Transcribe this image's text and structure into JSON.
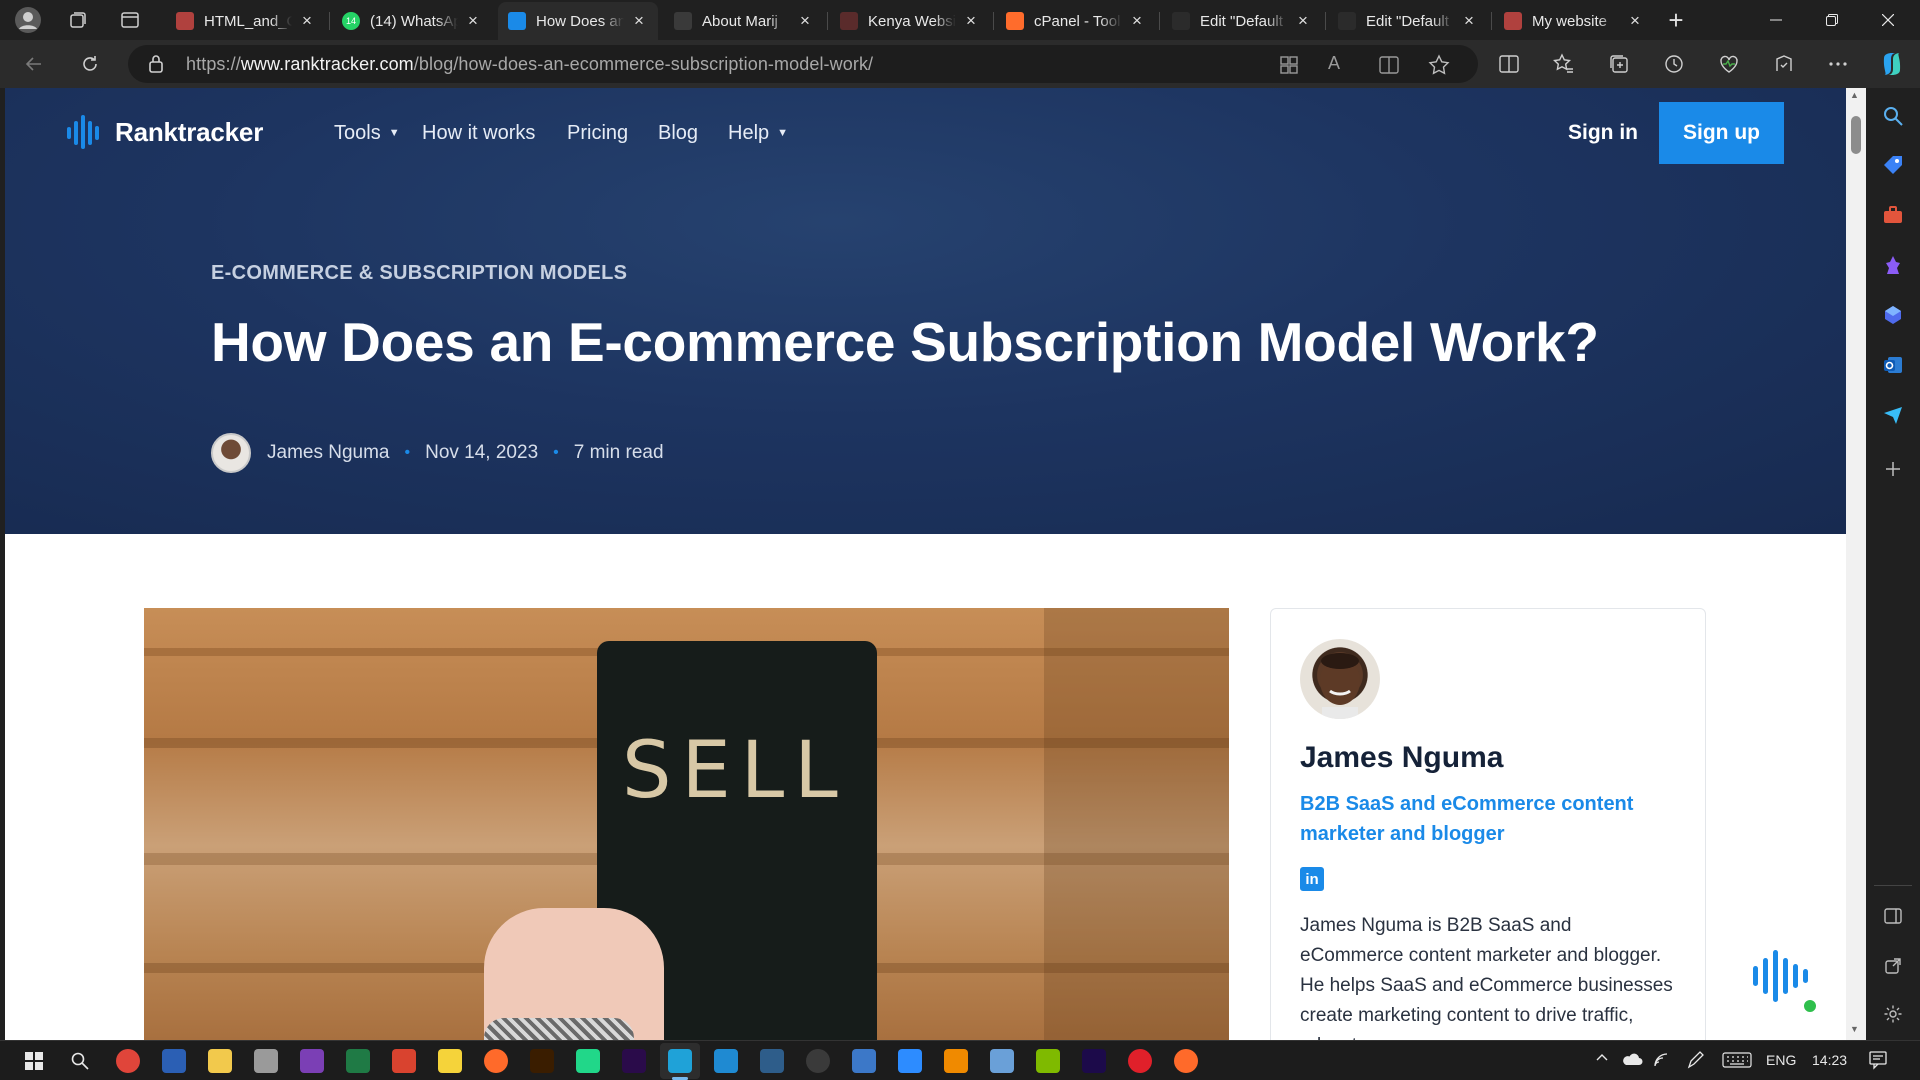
{
  "browser": {
    "tabs": [
      {
        "title": "HTML_and_C",
        "favicon_color": "#b0413e"
      },
      {
        "title": "(14) WhatsAp",
        "favicon_color": "#25d366",
        "badge": "14"
      },
      {
        "title": "How Does an",
        "favicon_color": "#1a8ae8",
        "active": true
      },
      {
        "title": "About Marij",
        "favicon_color": "#3a3a3a"
      },
      {
        "title": "Kenya Websi",
        "favicon_color": "#5a2b2b"
      },
      {
        "title": "cPanel - Tool",
        "favicon_color": "#ff6c2c"
      },
      {
        "title": "Edit \"Default",
        "favicon_color": "#2b2b2b"
      },
      {
        "title": "Edit \"Default",
        "favicon_color": "#2b2b2b"
      },
      {
        "title": "My website",
        "favicon_color": "#b0413e"
      }
    ],
    "close_glyph": "×",
    "new_tab_glyph": "+",
    "url_scheme": "https://",
    "url_domain": "www.ranktracker.com",
    "url_path": "/blog/how-does-an-ecommerce-subscription-model-work/"
  },
  "site": {
    "logo_text": "Ranktracker",
    "nav": [
      {
        "label": "Tools",
        "has_caret": true
      },
      {
        "label": "How it works",
        "has_caret": false
      },
      {
        "label": "Pricing",
        "has_caret": false
      },
      {
        "label": "Blog",
        "has_caret": false
      },
      {
        "label": "Help",
        "has_caret": true
      }
    ],
    "caret_glyph": "▼",
    "sign_in": "Sign in",
    "sign_up": "Sign up",
    "accent_color": "#1a8ae8",
    "hero_color": "#1d3460"
  },
  "article": {
    "category": "E-COMMERCE & SUBSCRIPTION MODELS",
    "title": "How Does an E-commerce Subscription Model Work?",
    "author": "James Nguma",
    "date": "Nov 14, 2023",
    "read_time": "7 min read",
    "meta_separator": "•",
    "image_text": "SELL"
  },
  "author_card": {
    "name": "James Nguma",
    "role": "B2B SaaS and eCommerce content marketer and blogger",
    "linkedin_label": "in",
    "bio": "James Nguma is B2B SaaS and eCommerce content marketer and blogger. He helps SaaS and eCommerce businesses create marketing content to drive traffic, educate"
  },
  "taskbar": {
    "apps": [
      "start-icon",
      "search-icon",
      "chrome-icon",
      "word-icon",
      "file-explorer-icon",
      "printer-icon",
      "onenote-icon",
      "excel-icon",
      "office-icon",
      "sticky-notes-icon",
      "firefox-icon",
      "illustrator-icon",
      "pycharm-icon",
      "premiere-icon",
      "edge-icon",
      "vscode-icon",
      "blender-icon",
      "obs-icon",
      "calculator-icon",
      "zoom-icon",
      "vlc-icon",
      "network-icon",
      "microsoft-store-icon",
      "after-effects-icon",
      "opera-icon",
      "firefox-icon"
    ],
    "language": "ENG",
    "time": "14:23"
  }
}
